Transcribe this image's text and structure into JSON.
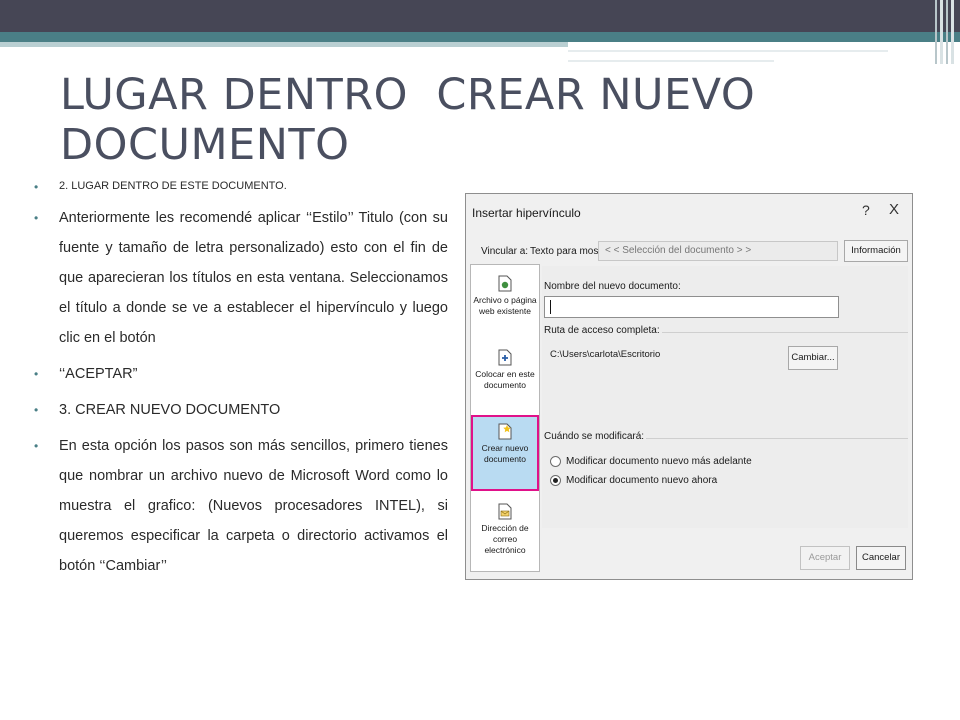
{
  "slide": {
    "title": "LUGAR DENTRO  CREAR NUEVO DOCUMENTO",
    "accent_color": "#4a7f86",
    "top_bar_color": "#464655",
    "bullets": [
      "2. LUGAR DENTRO DE ESTE DOCUMENTO.",
      "Anteriormente les recomendé aplicar ‘‘Estilo’’ Titulo (con su fuente y tamaño de letra personalizado) esto con el fin de que aparecieran los títulos en esta ventana. Seleccionamos el título a donde se ve a establecer el hipervínculo y luego clic en el botón",
      "‘‘ACEPTAR”",
      "3. CREAR NUEVO DOCUMENTO",
      "En esta opción los pasos son más sencillos, primero tienes que nombrar un archivo nuevo de Microsoft Word como lo muestra el grafico: (Nuevos procesadores INTEL), si queremos especificar la carpeta o directorio activamos el botón ‘‘Cambiar’’"
    ]
  },
  "dialog": {
    "title": "Insertar hipervínculo",
    "help": "?",
    "close": "X",
    "vincular_label": "Vincular a:",
    "texto_label": "Texto para mostrar:",
    "texto_value": "< < Selección del documento > >",
    "info_button": "Información en...",
    "link_types": [
      "Archivo o página web existente",
      "Colocar en este documento",
      "Crear nuevo documento",
      "Dirección de correo electrónico"
    ],
    "selected_link_type": "Crear nuevo documento",
    "selection_color": "#e0118a",
    "nombre_label": "Nombre del nuevo documento:",
    "nombre_value": "",
    "ruta_label": "Ruta de acceso completa:",
    "ruta_value": "C:\\Users\\carlota\\Escritorio",
    "cambiar_button": "Cambiar...",
    "cuando_label": "Cuándo se modificará:",
    "radio_later": "Modificar documento nuevo más adelante",
    "radio_now": "Modificar documento nuevo ahora",
    "radio_selected": "Modificar documento nuevo ahora",
    "aceptar_button": "Aceptar",
    "cancelar_button": "Cancelar"
  }
}
